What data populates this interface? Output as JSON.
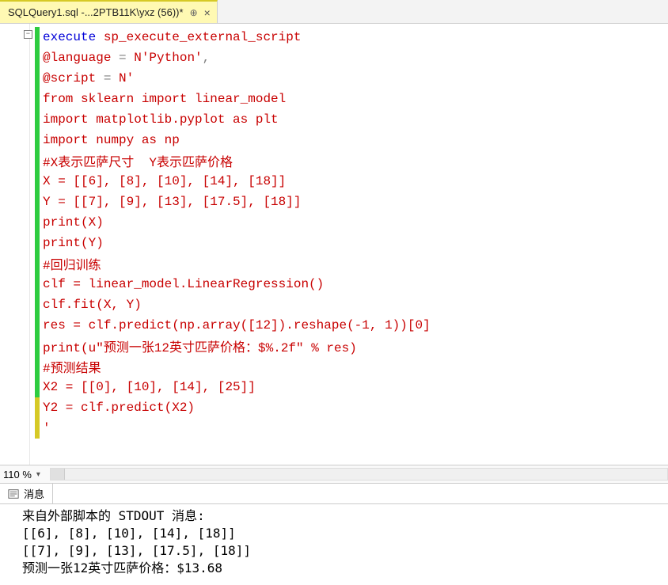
{
  "tab": {
    "title": "SQLQuery1.sql -...2PTB11K\\yxz (56))*",
    "pin_glyph": "⊕",
    "close_glyph": "×"
  },
  "editor": {
    "outline_glyph": "−",
    "zoom_label": "110 %",
    "dropdown_glyph": "▾",
    "lines": [
      {
        "bar": "green",
        "spans": [
          {
            "t": "execute",
            "c": "k-blue"
          },
          {
            "t": " sp_execute_external_script",
            "c": "k-red"
          }
        ]
      },
      {
        "bar": "green",
        "spans": [
          {
            "t": "@language ",
            "c": "k-red"
          },
          {
            "t": "=",
            "c": "k-gray"
          },
          {
            "t": " N",
            "c": "k-red"
          },
          {
            "t": "'Python'",
            "c": "k-red"
          },
          {
            "t": ",",
            "c": "k-gray"
          }
        ]
      },
      {
        "bar": "green",
        "spans": [
          {
            "t": "@script ",
            "c": "k-red"
          },
          {
            "t": "=",
            "c": "k-gray"
          },
          {
            "t": " N",
            "c": "k-red"
          },
          {
            "t": "'",
            "c": "k-red"
          }
        ]
      },
      {
        "bar": "green",
        "spans": [
          {
            "t": "from sklearn import linear_model",
            "c": "k-red"
          }
        ]
      },
      {
        "bar": "green",
        "spans": [
          {
            "t": "import matplotlib.pyplot as plt",
            "c": "k-red"
          }
        ]
      },
      {
        "bar": "green",
        "spans": [
          {
            "t": "import numpy as np",
            "c": "k-red"
          }
        ]
      },
      {
        "bar": "green",
        "spans": [
          {
            "t": "#X表示匹萨尺寸  Y表示匹萨价格",
            "c": "k-red"
          }
        ]
      },
      {
        "bar": "green",
        "spans": [
          {
            "t": "X = [[6], [8], [10], [14], [18]]",
            "c": "k-red"
          }
        ]
      },
      {
        "bar": "green",
        "spans": [
          {
            "t": "Y = [[7], [9], [13], [17.5], [18]]",
            "c": "k-red"
          }
        ]
      },
      {
        "bar": "green",
        "spans": [
          {
            "t": "print(X)",
            "c": "k-red"
          }
        ]
      },
      {
        "bar": "green",
        "spans": [
          {
            "t": "print(Y)",
            "c": "k-red"
          }
        ]
      },
      {
        "bar": "green",
        "spans": [
          {
            "t": "#回归训练",
            "c": "k-red"
          }
        ]
      },
      {
        "bar": "green",
        "spans": [
          {
            "t": "clf = linear_model.LinearRegression()",
            "c": "k-red"
          }
        ]
      },
      {
        "bar": "green",
        "spans": [
          {
            "t": "clf.fit(X, Y)",
            "c": "k-red"
          }
        ]
      },
      {
        "bar": "green",
        "spans": [
          {
            "t": "res = clf.predict(np.array([12]).reshape(-1, 1))[0]",
            "c": "k-red"
          }
        ]
      },
      {
        "bar": "green",
        "spans": [
          {
            "t": "print(u\"预测一张12英寸匹萨价格：$%.2f\" % res)",
            "c": "k-red"
          }
        ]
      },
      {
        "bar": "green",
        "spans": [
          {
            "t": "#预测结果",
            "c": "k-red"
          }
        ]
      },
      {
        "bar": "green",
        "spans": [
          {
            "t": "X2 = [[0], [10], [14], [25]]",
            "c": "k-red"
          }
        ]
      },
      {
        "bar": "yellow",
        "spans": [
          {
            "t": "Y2 = clf.predict(X2)",
            "c": "k-red"
          }
        ]
      },
      {
        "bar": "yellow",
        "spans": [
          {
            "t": "'",
            "c": "k-red"
          }
        ]
      }
    ]
  },
  "messages": {
    "tab_label": "消息",
    "lines": [
      "来自外部脚本的 STDOUT 消息:",
      "[[6], [8], [10], [14], [18]]",
      "[[7], [9], [13], [17.5], [18]]",
      "预测一张12英寸匹萨价格：$13.68"
    ]
  }
}
